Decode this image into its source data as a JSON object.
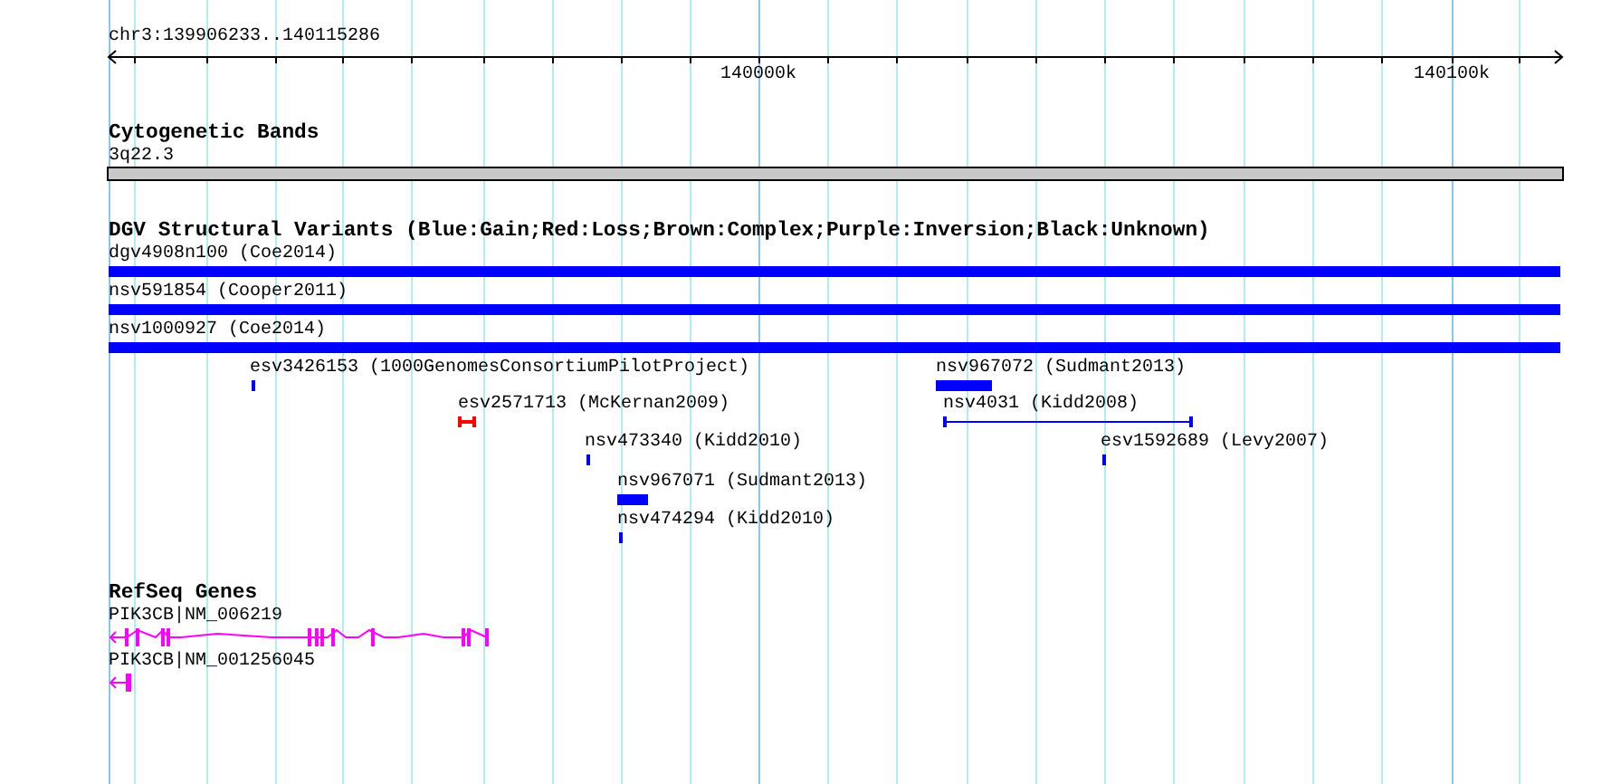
{
  "ruler": {
    "range": "chr3:139906233..140115286",
    "ticks": [
      "140000k",
      "140100k"
    ]
  },
  "tracks": [
    {
      "kind": "bands",
      "title": "Cytogenetic Bands",
      "features": [
        {
          "label": "3q22.3"
        }
      ]
    },
    {
      "kind": "variants",
      "title": "DGV Structural Variants (Blue:Gain;Red:Loss;Brown:Complex;Purple:Inversion;Black:Unknown)",
      "features": [
        {
          "label": "dgv4908n100 (Coe2014)",
          "kind": "bar",
          "color": "#0000ff"
        },
        {
          "label": "nsv591854 (Cooper2011)",
          "kind": "bar",
          "color": "#0000ff"
        },
        {
          "label": "nsv1000927 (Coe2014)",
          "kind": "bar",
          "color": "#0000ff"
        },
        {
          "label": "esv3426153 (1000GenomesConsortiumPilotProject)",
          "kind": "bar",
          "color": "#0000ff"
        },
        {
          "label": "esv2571713 (McKernan2009)",
          "kind": "span",
          "color": "#ff0000"
        },
        {
          "label": "nsv473340 (Kidd2010)",
          "kind": "bar",
          "color": "#0000ff"
        },
        {
          "label": "nsv967071 (Sudmant2013)",
          "kind": "bar",
          "color": "#0000ff"
        },
        {
          "label": "nsv474294 (Kidd2010)",
          "kind": "bar",
          "color": "#0000ff"
        },
        {
          "label": "nsv967072 (Sudmant2013)",
          "kind": "bar",
          "color": "#0000ff"
        },
        {
          "label": "nsv4031 (Kidd2008)",
          "kind": "span",
          "color": "#0000ff"
        },
        {
          "label": "esv1592689 (Levy2007)",
          "kind": "bar",
          "color": "#0000ff"
        }
      ]
    },
    {
      "kind": "genes",
      "title": "RefSeq Genes",
      "features": [
        {
          "label": "PIK3CB|NM_006219"
        },
        {
          "label": "PIK3CB|NM_001256045"
        }
      ]
    }
  ]
}
